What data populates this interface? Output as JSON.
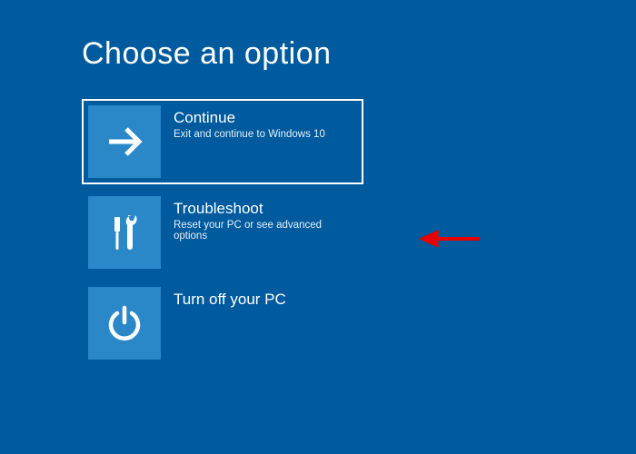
{
  "title": "Choose an option",
  "options": [
    {
      "label": "Continue",
      "description": "Exit and continue to Windows 10",
      "icon": "arrow-right-icon",
      "selected": true
    },
    {
      "label": "Troubleshoot",
      "description": "Reset your PC or see advanced options",
      "icon": "tools-icon",
      "selected": false
    },
    {
      "label": "Turn off your PC",
      "description": "",
      "icon": "power-icon",
      "selected": false
    }
  ],
  "annotation": {
    "color": "#e60000"
  }
}
